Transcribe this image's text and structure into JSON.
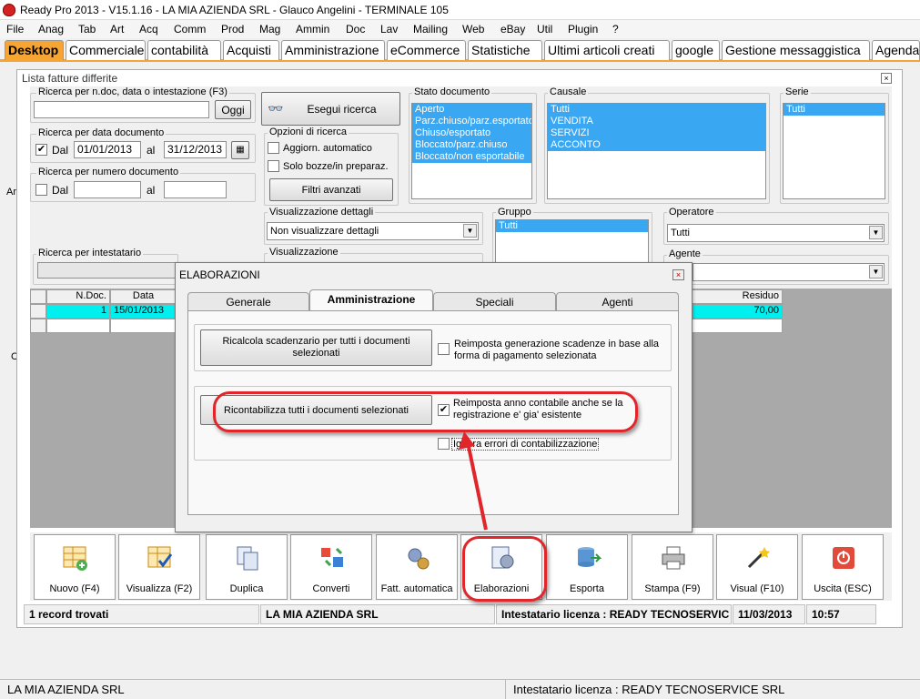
{
  "window": {
    "title": "Ready Pro 2013 - V15.1.16 - LA MIA AZIENDA SRL - Glauco Angelini - TERMINALE 105"
  },
  "menu": [
    "File",
    "Anag",
    "Tab",
    "Art",
    "Acq",
    "Comm",
    "Prod",
    "Mag",
    "Ammin",
    "Doc",
    "Lav",
    "Mailing",
    "Web",
    "eBay",
    "Util",
    "Plugin",
    "?"
  ],
  "tabs": [
    "Desktop",
    "Commerciale",
    "contabilità",
    "Acquisti",
    "Amministrazione",
    "eCommerce",
    "Statistiche",
    "Ultimi articoli creati",
    "google",
    "Gestione messaggistica",
    "Agenda"
  ],
  "panel": {
    "title": "Lista fatture differite",
    "search_ndoc": {
      "label": "Ricerca per n.doc, data o intestazione (F3)",
      "value": "",
      "button": "Oggi"
    },
    "execute": "Esegui ricerca",
    "search_date": {
      "label": "Ricerca per data documento",
      "from_label": "Dal",
      "from": "01/01/2013",
      "to_label": "al",
      "to": "31/12/2013"
    },
    "search_number": {
      "label": "Ricerca per numero documento",
      "from_label": "Dal",
      "to_label": "al"
    },
    "search_holder": {
      "label": "Ricerca per intestatario"
    },
    "options": {
      "label": "Opzioni di ricerca",
      "auto": "Aggiorn. automatico",
      "drafts": "Solo bozze/in preparaz.",
      "filters": "Filtri avanzati"
    },
    "stato": {
      "label": "Stato documento",
      "items": [
        "Aperto",
        "Parz.chiuso/parz.esportato",
        "Chiuso/esportato",
        "Bloccato/parz.chiuso",
        "Bloccato/non esportabile"
      ]
    },
    "causale": {
      "label": "Causale",
      "items": [
        "Tutti",
        "VENDITA",
        "SERVIZI",
        "ACCONTO"
      ]
    },
    "serie": {
      "label": "Serie",
      "items": [
        "Tutti"
      ]
    },
    "details": {
      "label": "Visualizzazione dettagli",
      "value": "Non visualizzare dettagli"
    },
    "visual": {
      "label": "Visualizzazione"
    },
    "gruppo": {
      "label": "Gruppo",
      "items": [
        "Tutti"
      ]
    },
    "operatore": {
      "label": "Operatore",
      "value": "Tutti"
    },
    "agente": {
      "label": "Agente"
    },
    "grid": {
      "headers": {
        "ndoc": "N.Doc.",
        "date": "Data",
        "residuo": "Residuo"
      },
      "rows": [
        {
          "ndoc": "1",
          "date": "15/01/2013",
          "residuo": "70,00"
        }
      ]
    },
    "toolbar": [
      "Nuovo (F4)",
      "Visualizza (F2)",
      "Duplica",
      "Converti",
      "Fatt. automatica",
      "Elaborazioni",
      "Esporta",
      "Stampa (F9)",
      "Visual (F10)",
      "Uscita (ESC)"
    ],
    "status": {
      "records": "1 record trovati",
      "company": "LA MIA AZIENDA SRL",
      "license": "Intestatario licenza : READY TECNOSERVIC",
      "date": "11/03/2013",
      "time": "10:57"
    }
  },
  "side_letters": [
    "Ar",
    "C"
  ],
  "dialog": {
    "title": "ELABORAZIONI",
    "tabs": [
      "Generale",
      "Amministrazione",
      "Speciali",
      "Agenti"
    ],
    "recalc_button": "Ricalcola scadenzario per tutti i documenti selezionati",
    "recalc_option": "Reimposta generazione scadenze in base alla forma di pagamento selezionata",
    "recontab_button": "Ricontabilizza tutti i documenti selezionati",
    "reset_year": "Reimposta anno contabile anche se la registrazione e' gia' esistente",
    "ignore_errors": "Ignora errori di contabilizzazione"
  },
  "bottom": {
    "company": "LA MIA AZIENDA SRL",
    "license": "Intestatario licenza : READY TECNOSERVICE SRL"
  },
  "colors": {
    "accent": "#f6a534",
    "selection": "#39a7f1",
    "row_highlight": "#00f0f0",
    "annotation": "#e0262b"
  }
}
